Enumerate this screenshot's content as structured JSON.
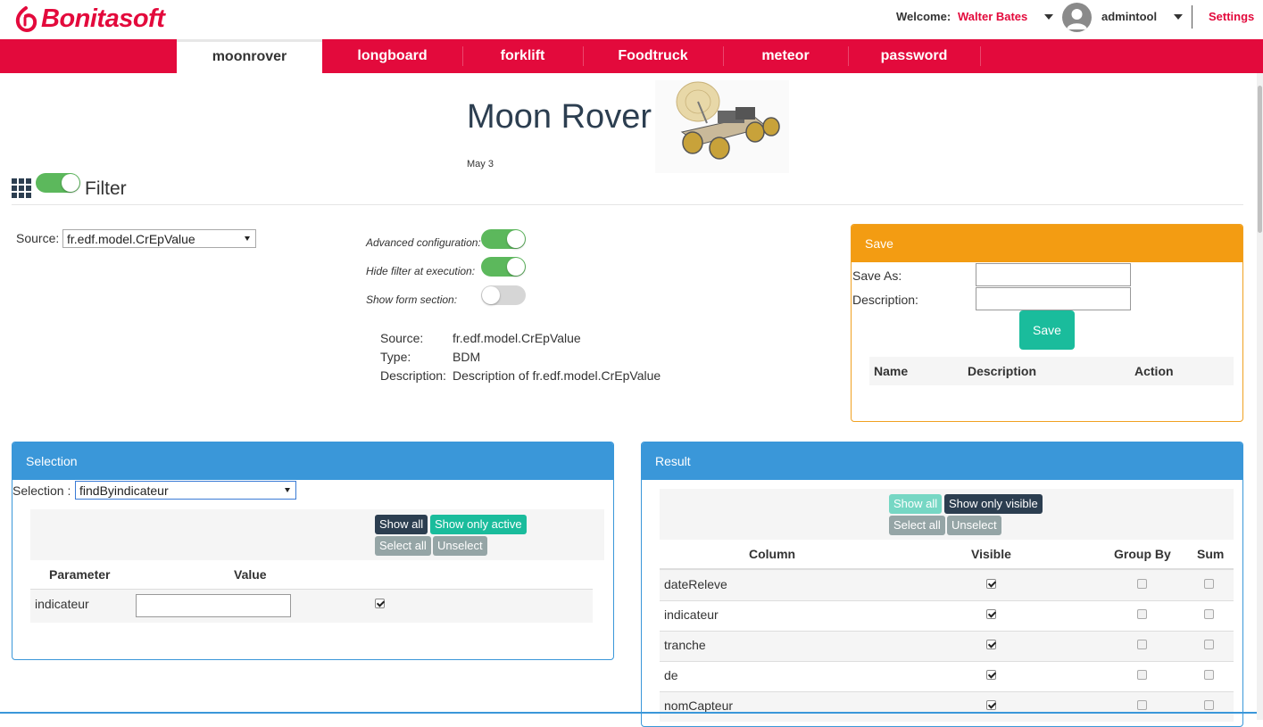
{
  "header": {
    "brand": "Bonitasoft",
    "welcome_label": "Welcome:",
    "welcome_user": "Walter Bates",
    "username": "admintool",
    "settings_label": "Settings"
  },
  "nav": {
    "tabs": [
      {
        "label": "moonrover",
        "active": true
      },
      {
        "label": "longboard",
        "active": false
      },
      {
        "label": "forklift",
        "active": false
      },
      {
        "label": "Foodtruck",
        "active": false
      },
      {
        "label": "meteor",
        "active": false
      },
      {
        "label": "password",
        "active": false
      }
    ]
  },
  "page": {
    "title": "Moon Rover",
    "date": "May 3",
    "image": "moon-rover-image"
  },
  "filter": {
    "label": "Filter",
    "enabled": true,
    "icon": "grid-icon"
  },
  "source": {
    "label": "Source:",
    "selected": "fr.edf.model.CrEpValue"
  },
  "config": {
    "advanced_label": "Advanced configuration:",
    "advanced_on": true,
    "hide_filter_label": "Hide filter at execution:",
    "hide_filter_on": true,
    "show_form_label": "Show form section:",
    "show_form_on": false
  },
  "source_info": {
    "source_key": "Source:",
    "source_val": "fr.edf.model.CrEpValue",
    "type_key": "Type:",
    "type_val": "BDM",
    "desc_key": "Description:",
    "desc_val": "Description of fr.edf.model.CrEpValue"
  },
  "save": {
    "title": "Save",
    "save_as_label": "Save As:",
    "save_as_value": "",
    "description_label": "Description:",
    "description_value": "",
    "button_label": "Save",
    "columns": [
      "Name",
      "Description",
      "Action"
    ]
  },
  "selection": {
    "title": "Selection",
    "selection_label": "Selection :",
    "selected": "findByindicateur",
    "show_all": "Show all",
    "show_only_active": "Show only active",
    "select_all": "Select all",
    "unselect": "Unselect",
    "col_parameter": "Parameter",
    "col_value": "Value",
    "rows": [
      {
        "parameter": "indicateur",
        "value": "",
        "active": true
      }
    ]
  },
  "result": {
    "title": "Result",
    "show_all": "Show all",
    "show_only_visible": "Show only visible",
    "select_all": "Select all",
    "unselect": "Unselect",
    "col_column": "Column",
    "col_visible": "Visible",
    "col_group_by": "Group By",
    "col_sum": "Sum",
    "rows": [
      {
        "column": "dateReleve",
        "visible": true,
        "group_by": false,
        "sum": false
      },
      {
        "column": "indicateur",
        "visible": true,
        "group_by": false,
        "sum": false
      },
      {
        "column": "tranche",
        "visible": true,
        "group_by": false,
        "sum": false
      },
      {
        "column": "de",
        "visible": true,
        "group_by": false,
        "sum": false
      },
      {
        "column": "nomCapteur",
        "visible": true,
        "group_by": false,
        "sum": false
      }
    ]
  },
  "colors": {
    "brand_red": "#e30a3c",
    "save_orange": "#f39c12",
    "panel_blue": "#3a97d9",
    "teal": "#1abc9c",
    "toggle_green": "#5cb85c"
  }
}
